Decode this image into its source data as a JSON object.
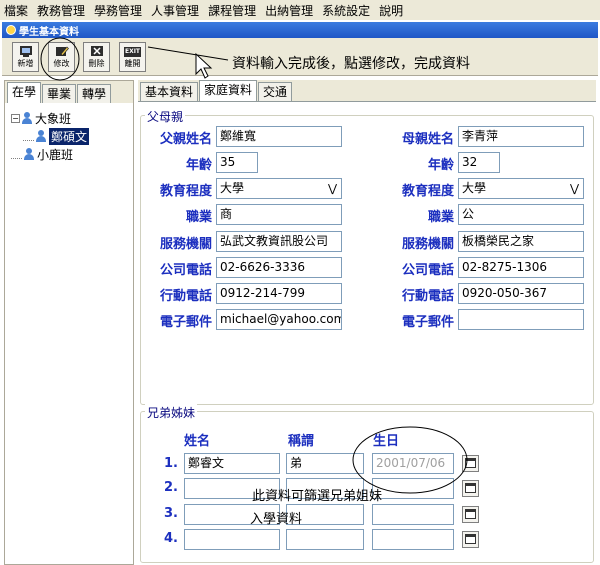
{
  "menu": [
    "檔案",
    "教務管理",
    "學務管理",
    "人事管理",
    "課程管理",
    "出納管理",
    "系統設定",
    "說明"
  ],
  "window_title": "學生基本資料",
  "toolbar": {
    "new_label": "新增",
    "edit_label": "修改",
    "delete_label": "刪除",
    "exit_badge": "EXIT",
    "exit_label": "離開"
  },
  "callout": "資料輸入完成後，點選修改，完成資料",
  "left_tabs": [
    "在學",
    "畢業",
    "轉學"
  ],
  "tree": {
    "class1": "大象班",
    "student1": "鄭碩文",
    "class2": "小鹿班"
  },
  "right_tabs": [
    "基本資料",
    "家庭資料",
    "交通"
  ],
  "parents": {
    "title": "父母親",
    "father_name_label": "父親姓名",
    "father_name": "鄭維寬",
    "mother_name_label": "母親姓名",
    "mother_name": "李青萍",
    "age_label": "年齡",
    "father_age": "35",
    "mother_age": "32",
    "education_label": "教育程度",
    "father_education": "大學",
    "mother_education": "大學",
    "job_label": "職業",
    "father_job": "商",
    "mother_job": "公",
    "employer_label": "服務機關",
    "father_employer": "弘武文教資訊股公司",
    "mother_employer": "板橋榮民之家",
    "office_phone_label": "公司電話",
    "father_office_phone": "02-6626-3336",
    "mother_office_phone": "02-8275-1306",
    "mobile_label": "行動電話",
    "father_mobile": "0912-214-799",
    "mother_mobile": "0920-050-367",
    "email_label": "電子郵件",
    "father_email": "michael@yahoo.com",
    "mother_email": ""
  },
  "siblings": {
    "title": "兄弟姊妹",
    "col_name": "姓名",
    "col_relation": "稱謂",
    "col_birthday": "生日",
    "rows": [
      {
        "num": "1.",
        "name": "鄭睿文",
        "relation": "弟",
        "birthday": "2001/07/06"
      },
      {
        "num": "2.",
        "name": "",
        "relation": "",
        "birthday": ""
      },
      {
        "num": "3.",
        "name": "",
        "relation": "",
        "birthday": ""
      },
      {
        "num": "4.",
        "name": "",
        "relation": "",
        "birthday": ""
      }
    ],
    "note_line1": "此資料可篩選兄弟姐妹",
    "note_line2": "入學資料"
  },
  "colors": {
    "label_blue": "#1c2fbf",
    "title_bar": "#1f56c6",
    "selected": "#0a246a"
  }
}
